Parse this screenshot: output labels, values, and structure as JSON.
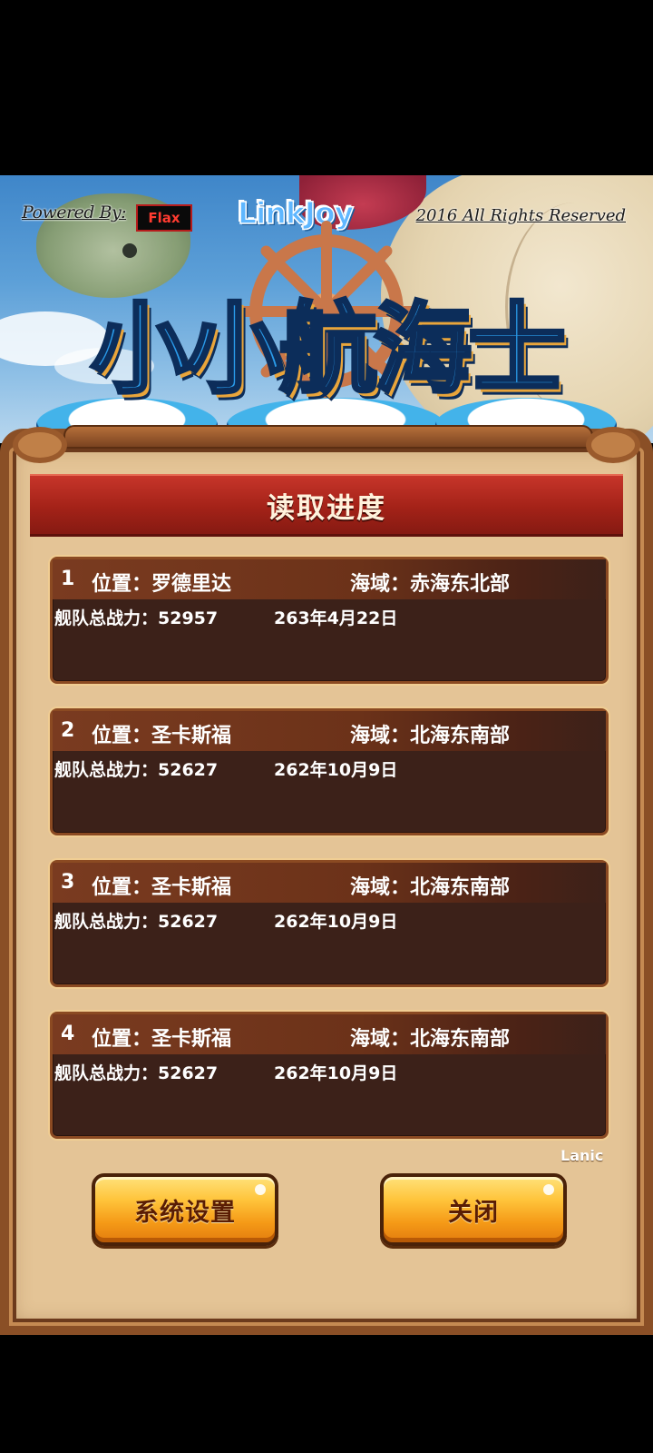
{
  "banner": {
    "powered_by": "Powered By:",
    "flax": "Flax",
    "publisher": "LinkJoy",
    "rights": "2016 All Rights Reserved",
    "game_title": "小小航海士"
  },
  "panel": {
    "title": "读取进度",
    "slots": [
      {
        "num": "1",
        "location": "位置：罗德里达",
        "sea": "海域：赤海东北部",
        "power": "舰队总战力：52957",
        "date": "263年4月22日"
      },
      {
        "num": "2",
        "location": "位置：圣卡斯福",
        "sea": "海域：北海东南部",
        "power": "舰队总战力：52627",
        "date": "262年10月9日"
      },
      {
        "num": "3",
        "location": "位置：圣卡斯福",
        "sea": "海域：北海东南部",
        "power": "舰队总战力：52627",
        "date": "262年10月9日"
      },
      {
        "num": "4",
        "location": "位置：圣卡斯福",
        "sea": "海域：北海东南部",
        "power": "舰队总战力：52627",
        "date": "262年10月9日"
      }
    ],
    "watermark": "Lanic"
  },
  "buttons": {
    "settings": "系统设置",
    "close": "关闭"
  },
  "colors": {
    "title_bar": "#a32218",
    "slot_bg": "#3c2119",
    "panel_bg": "#e4c496",
    "button": "#ffc43b"
  }
}
